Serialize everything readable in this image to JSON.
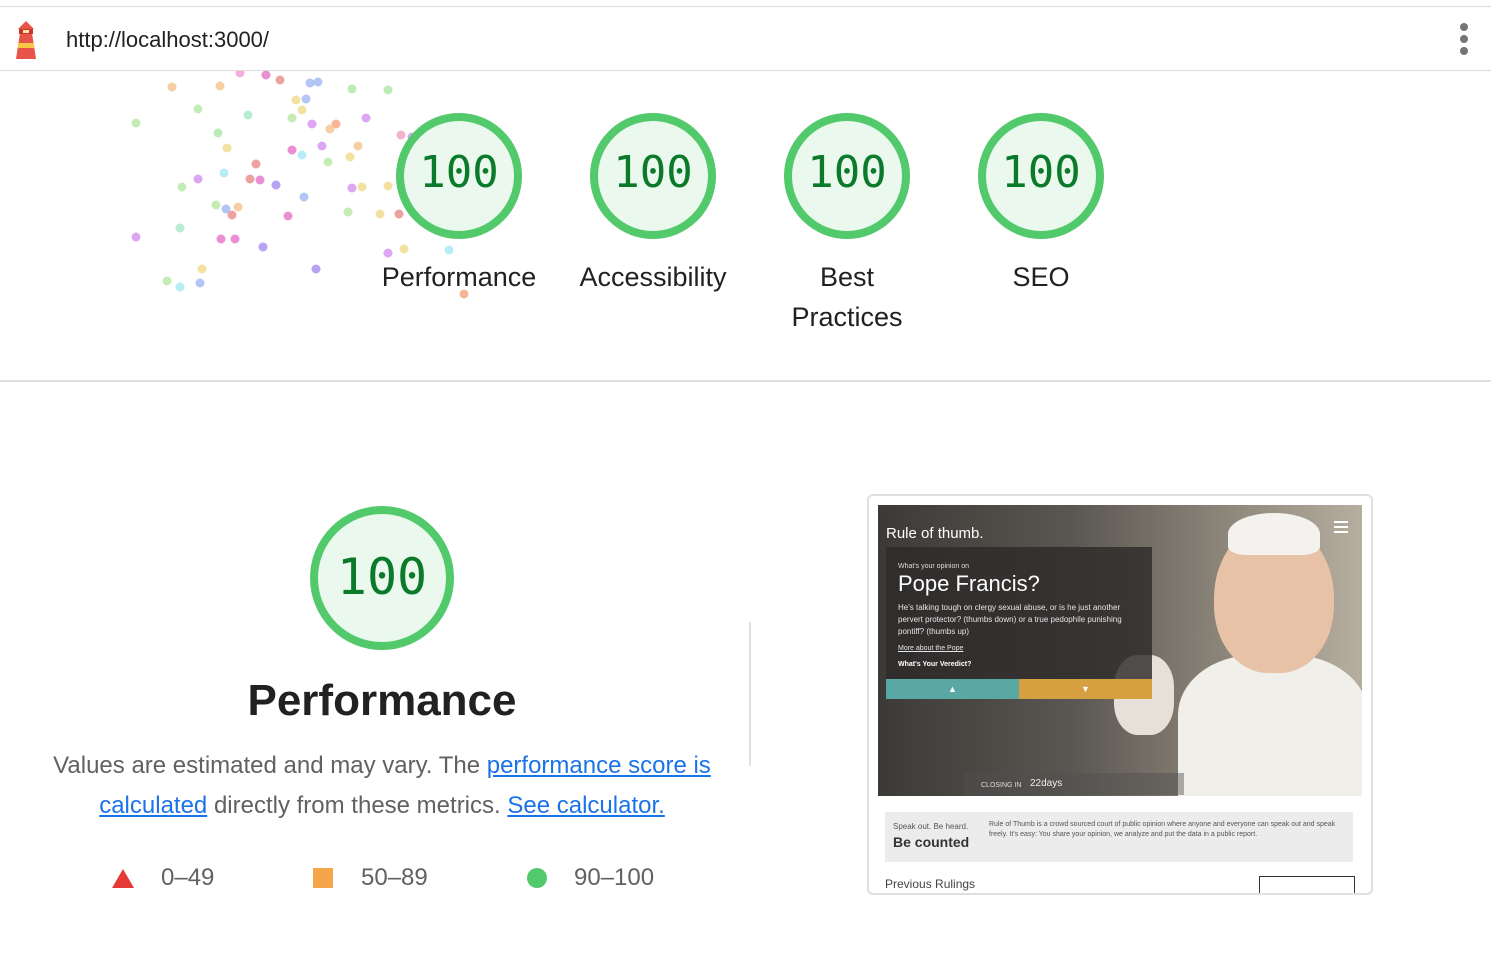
{
  "browser": {
    "url": "http://localhost:3000/",
    "logo_icon": "lighthouse-icon",
    "menu_icon": "kebab-menu-icon"
  },
  "gauges": [
    {
      "score": "100",
      "label": "Performance"
    },
    {
      "score": "100",
      "label": "Accessibility"
    },
    {
      "score": "100",
      "label": "Best Practices"
    },
    {
      "score": "100",
      "label": "SEO"
    }
  ],
  "performance": {
    "score": "100",
    "title": "Performance",
    "desc_part1": "Values are estimated and may vary. The ",
    "link_score": "performance score is calculated",
    "desc_part2": " directly from these metrics. ",
    "link_calc": "See calculator."
  },
  "legend": [
    {
      "range": "0–49",
      "shape": "triangle",
      "color": "#e53935"
    },
    {
      "range": "50–89",
      "shape": "square",
      "color": "#f6a54a"
    },
    {
      "range": "90–100",
      "shape": "circle",
      "color": "#52c96a"
    }
  ],
  "screenshot": {
    "brand": "Rule of thumb.",
    "card_small": "What's your opinion on",
    "card_title": "Pope Francis?",
    "card_body": "He's talking tough on clergy sexual abuse, or is he just another pervert protector? (thumbs down) or a true pedophile punishing pontiff? (thumbs up)",
    "card_link": "More about the Pope",
    "card_verdict": "What's Your Veredict?",
    "closing_label": "CLOSING IN",
    "closing_days": "22days",
    "speak_out": "Speak out. Be heard.",
    "be_counted": "Be counted",
    "strip_desc": "Rule of Thumb is a crowd sourced court of public opinion where anyone and everyone can speak out and speak freely. It's easy: You share your opinion, we analyze and put the data in a public report.",
    "previous": "Previous Rulings"
  },
  "colors": {
    "pass_ring": "#52c96a",
    "pass_fill": "#eaf8ed",
    "pass_text": "#0b7a2b",
    "link": "#1a73e8"
  }
}
